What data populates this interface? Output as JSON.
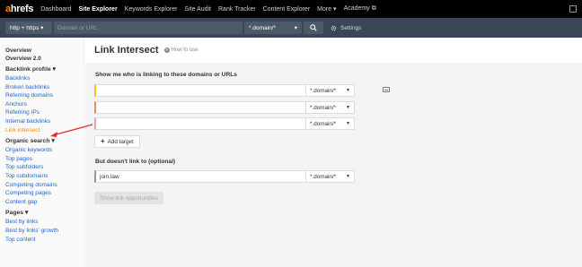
{
  "nav": {
    "logo_a": "a",
    "logo_rest": "hrefs",
    "items": [
      "Dashboard",
      "Site Explorer",
      "Keywords Explorer",
      "Site Audit",
      "Rank Tracker",
      "Content Explorer",
      "More ▾",
      "Academy ⧉"
    ],
    "active_index": 1
  },
  "search": {
    "protocol": "http + https ▾",
    "placeholder": "Domain or URL",
    "mode": "*.domain/*",
    "mode_caret": "▾",
    "search_icon": "search-icon",
    "settings_label": "Settings"
  },
  "sidebar": {
    "overview": "Overview",
    "overview2": "Overview 2.0",
    "backlink_profile": {
      "title": "Backlink profile ▾",
      "links": [
        "Backlinks",
        "Broken backlinks",
        "Referring domains",
        "Anchors",
        "Referring IPs",
        "Internal backlinks",
        "Link intersect"
      ]
    },
    "organic_search": {
      "title": "Organic search ▾",
      "links": [
        "Organic keywords",
        "Top pages",
        "Top subfolders",
        "Top subdomains",
        "Competing domains",
        "Competing pages",
        "Content gap"
      ]
    },
    "pages": {
      "title": "Pages ▾",
      "links": [
        "Best by links",
        "Best by links' growth",
        "Top content"
      ]
    }
  },
  "main": {
    "title": "Link Intersect",
    "howto": "How to use",
    "section1": "Show me who is linking to these domains or URLs",
    "targets": [
      {
        "value": "",
        "mode": "*.domain/*",
        "accent": "#f5c518"
      },
      {
        "value": "",
        "mode": "*.domain/*",
        "accent": "#f08a5d"
      },
      {
        "value": "",
        "mode": "*.domain/*",
        "accent": "#e7a3b5"
      }
    ],
    "add_target": "Add target",
    "section2": "But doesn't link to (optional)",
    "exclude": {
      "value": "join.law",
      "mode": "*.domain/*",
      "accent": "#8d97a3"
    },
    "show_button": "Show link opportunities"
  },
  "colors": {
    "brand": "#ff8800",
    "link": "#2064d4",
    "annotation_arrow": "#e52a2a"
  }
}
